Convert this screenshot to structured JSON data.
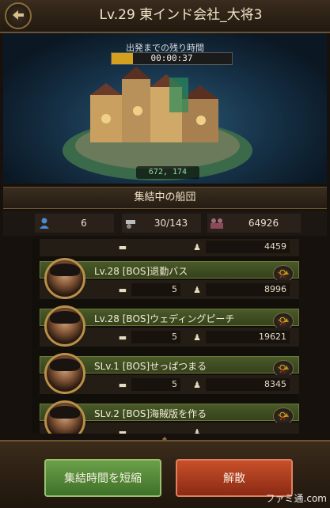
{
  "header": {
    "title": "Lv.29 東インド会社_大将3",
    "back_icon": "back-arrow-icon"
  },
  "map": {
    "timer_label": "出発までの残り時間",
    "timer_value": "00:00:37",
    "timer_progress": 0.18,
    "coords": "672, 174"
  },
  "section": {
    "title": "集結中の船団"
  },
  "stats": {
    "members": "6",
    "capacity": "30/143",
    "power": "64926"
  },
  "fleet": [
    {
      "name": "",
      "ships": "",
      "power": "4459",
      "partial": true
    },
    {
      "name": "Lv.28 [BOS]退勤バス",
      "ships": "5",
      "power": "8996"
    },
    {
      "name": "Lv.28 [BOS]ウェディングピーチ",
      "ships": "5",
      "power": "19621"
    },
    {
      "name": "SLv.1 [BOS]せっぱつまる",
      "ships": "5",
      "power": "8345"
    },
    {
      "name": "SLv.2 [BOS]海賊版を作る",
      "ships": "",
      "power": "",
      "partial": true
    }
  ],
  "buttons": {
    "shorten": "集結時間を短縮",
    "disband": "解散"
  },
  "watermark": "ファミ通.com",
  "colors": {
    "accent_green": "#4e8a34",
    "accent_red": "#b03c1e",
    "gold": "#b89048"
  }
}
